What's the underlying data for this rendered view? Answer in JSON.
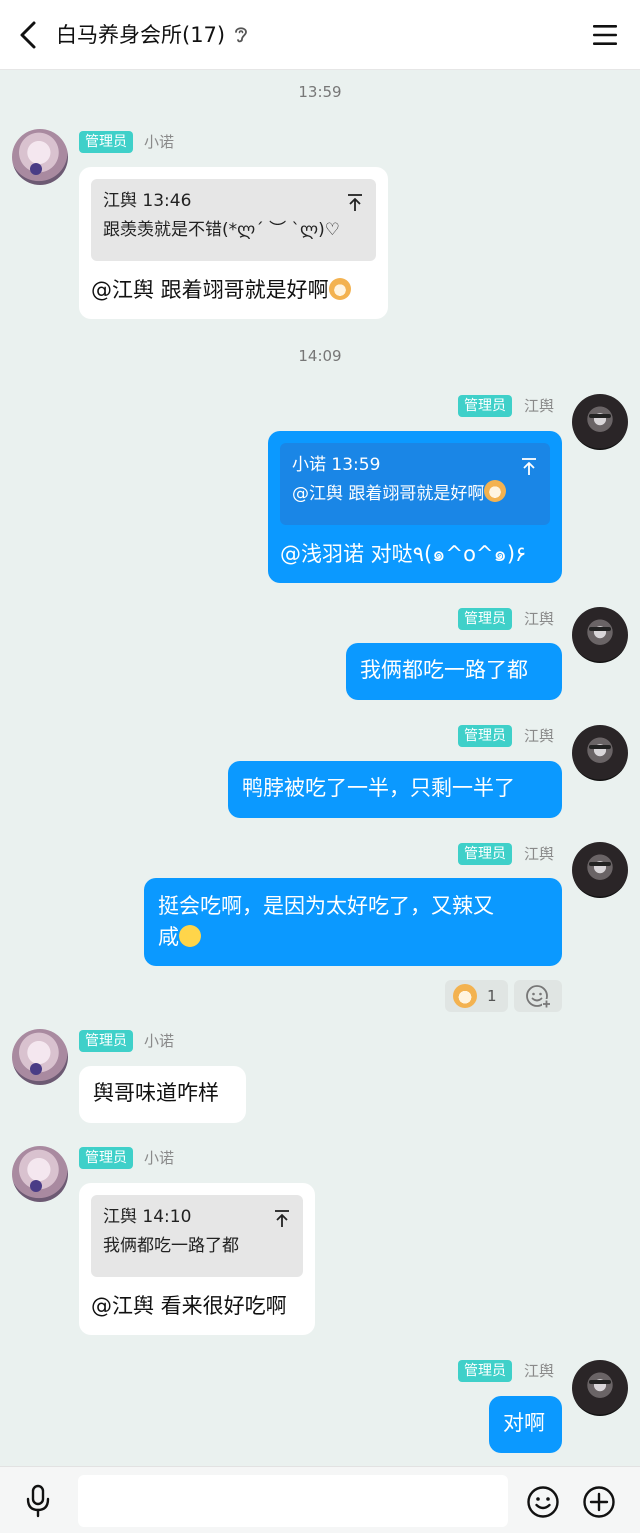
{
  "header": {
    "back_icon": "chevron-left-icon",
    "title": "白马养身会所(17)",
    "title_icon": "ear-icon",
    "menu_icon": "menu-icon"
  },
  "messages": {
    "time1": "13:59",
    "m1": {
      "badge": "管理员",
      "sender": "小诺",
      "quote_author_time": "江舆 13:46",
      "quote_text": "跟羡羡就是不错(*ლ´ ︶ `ლ)♡",
      "text": "@江舆 跟着翊哥就是好啊"
    },
    "time2": "14:09",
    "m2": {
      "badge": "管理员",
      "sender": "江舆",
      "quote_author_time": "小诺 13:59",
      "quote_text": "@江舆 跟着翊哥就是好啊",
      "text": "@浅羽诺 对哒٩(๑^o^๑)۶"
    },
    "m3": {
      "badge": "管理员",
      "sender": "江舆",
      "text": "我俩都吃一路了都"
    },
    "m4": {
      "badge": "管理员",
      "sender": "江舆",
      "text": "鸭脖被吃了一半，只剩一半了"
    },
    "m5": {
      "badge": "管理员",
      "sender": "江舆",
      "text_line1": "挺会吃啊，是因为太好吃了，又辣又",
      "text_line2": "咸"
    },
    "reactions": {
      "dog_count": "1"
    },
    "m6": {
      "badge": "管理员",
      "sender": "小诺",
      "text": "舆哥味道咋样"
    },
    "m7": {
      "badge": "管理员",
      "sender": "小诺",
      "quote_author_time": "江舆 14:10",
      "quote_text": "我俩都吃一路了都",
      "text": "@江舆 看来很好吃啊"
    },
    "m8": {
      "badge": "管理员",
      "sender": "江舆",
      "text": "对啊"
    }
  },
  "input": {
    "placeholder": ""
  },
  "colors": {
    "outgoing_bubble": "#0b99ff",
    "admin_badge": "#3fd0c9",
    "background": "#eaf1ef"
  }
}
